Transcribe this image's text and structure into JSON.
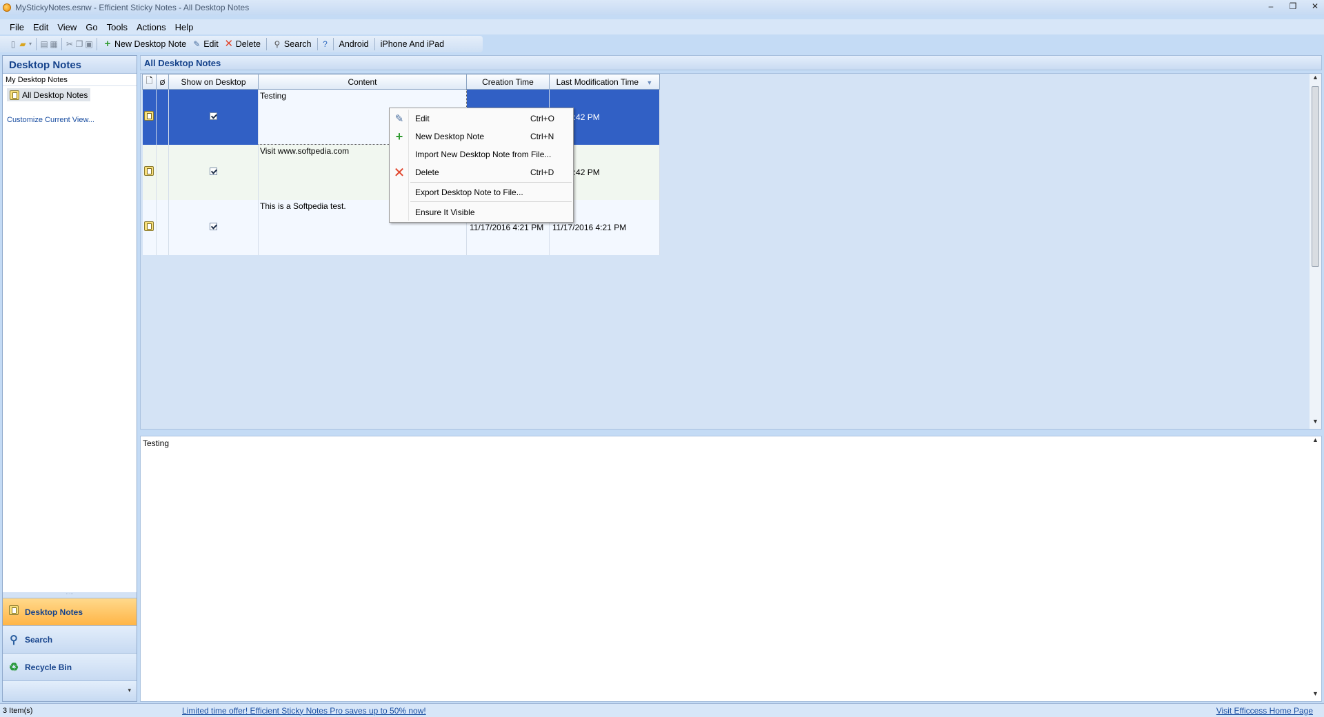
{
  "window": {
    "title": "MyStickyNotes.esnw - Efficient Sticky Notes - All Desktop Notes",
    "controls": [
      "–",
      "❐",
      "✕"
    ]
  },
  "menu": [
    "File",
    "Edit",
    "View",
    "Go",
    "Tools",
    "Actions",
    "Help"
  ],
  "toolbar": {
    "new_note": "New Desktop Note",
    "edit": "Edit",
    "delete": "Delete",
    "search": "Search",
    "android": "Android",
    "iphone": "iPhone And iPad"
  },
  "leftpane": {
    "header": "Desktop Notes",
    "group": "My Desktop Notes",
    "item": "All Desktop Notes",
    "customize": "Customize Current View..."
  },
  "nav": {
    "grip": "·····",
    "desktop_notes": "Desktop Notes",
    "search": "Search",
    "recycle_bin": "Recycle Bin",
    "more": "▾"
  },
  "main": {
    "header": "All Desktop Notes",
    "columns": [
      "Show on Desktop",
      "Content",
      "Creation Time",
      "Last Modification Time"
    ],
    "rows": [
      {
        "content": "Testing",
        "created": "",
        "modified": "11/17/2016 4:42 PM",
        "visible_modified": "6 4:42 PM"
      },
      {
        "content": "Visit www.softpedia.com",
        "created": "",
        "modified": "6 4:42 PM"
      },
      {
        "content": "This is a Softpedia test.",
        "created": "11/17/2016 4:21 PM",
        "modified": "11/17/2016 4:21 PM"
      }
    ],
    "preview_text": "Testing"
  },
  "context_menu": {
    "edit": "Edit",
    "edit_sc": "Ctrl+O",
    "new": "New Desktop Note",
    "new_sc": "Ctrl+N",
    "import": "Import New Desktop Note from File...",
    "delete": "Delete",
    "delete_sc": "Ctrl+D",
    "export": "Export Desktop Note to File...",
    "ensure": "Ensure It Visible"
  },
  "status": {
    "count": "3 Item(s)",
    "offer": "Limited time offer! Efficient Sticky Notes Pro saves up to 50% now!",
    "home": "Visit Efficcess Home Page"
  }
}
